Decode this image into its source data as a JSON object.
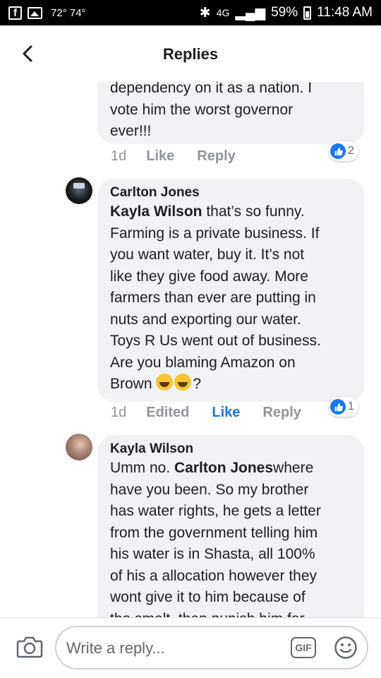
{
  "status_bar": {
    "temperature": "72° 74°",
    "network": "4G",
    "battery": "59%",
    "time": "11:48 AM"
  },
  "header": {
    "title": "Replies"
  },
  "comments": [
    {
      "text_lines": [
        "dependency on it as a nation.  I",
        "vote him the worst governor",
        "ever!!!"
      ],
      "time": "1d",
      "like_label": "Like",
      "reply_label": "Reply",
      "reaction_count": "2"
    },
    {
      "author": "Carlton Jones",
      "mention": "Kayla Wilson",
      "text_lines": [
        " that’s so funny.",
        "Farming is a private business. If",
        "you want water, buy it. It’s not",
        "like they give food away. More",
        "farmers than ever are putting in",
        "nuts and exporting our water.",
        "Toys R Us went out of business.",
        "Are you blaming Amazon on",
        "Brown ",
        "?"
      ],
      "emojis": [
        "rolling-on-floor-laughing-emoji",
        "grinning-sweat-emoji"
      ],
      "time": "1d",
      "edited_label": "Edited",
      "like_label": "Like",
      "reply_label": "Reply",
      "reaction_count": "1",
      "liked": true
    },
    {
      "author": "Kayla Wilson",
      "prefix": "Umm no. ",
      "mention": "Carlton Jones",
      "text_lines": [
        "where",
        "have you been. So my brother",
        "has water rights, he gets a letter",
        "from the government telling him",
        "his water is in Shasta, all 100%",
        "of his a allocation however they",
        "wont give it to him because of",
        "the smelt, then punish him for"
      ]
    }
  ],
  "composer": {
    "placeholder": "Write a reply...",
    "gif_label": "GIF"
  },
  "colors": {
    "accent": "#1877f2",
    "bubble": "#f0f2f5",
    "muted": "#90949c"
  }
}
